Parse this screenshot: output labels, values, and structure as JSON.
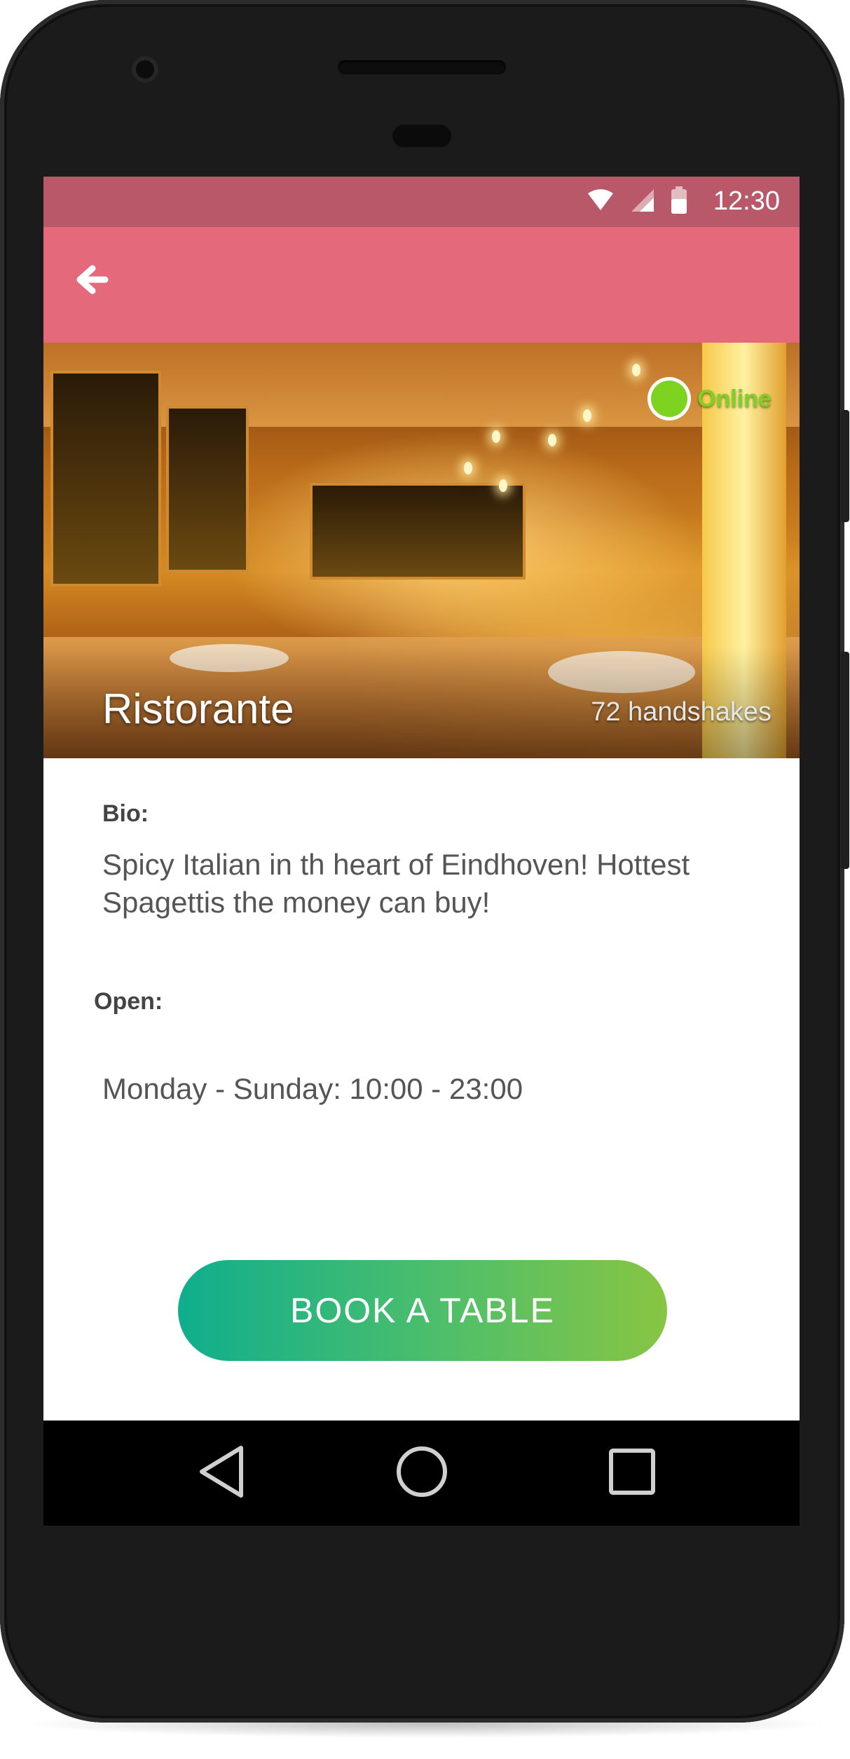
{
  "statusbar": {
    "time": "12:30"
  },
  "hero": {
    "title": "Ristorante",
    "handshakes": "72 handshakes",
    "status": "Online"
  },
  "bio": {
    "label": "Bio:",
    "text": "Spicy Italian in th heart of Eindhoven! Hottest Spagettis the money can buy!"
  },
  "open": {
    "label": "Open:",
    "hours": "Monday - Sunday: 10:00 - 23:00"
  },
  "cta": {
    "label": "BOOK A TABLE"
  },
  "colors": {
    "statusbar": "#b85868",
    "appbar": "#e46a7b",
    "online": "#7ed321",
    "button_start": "#0fae8d",
    "button_end": "#88c543"
  },
  "icons": {
    "back": "arrow-left-icon",
    "wifi": "wifi-icon",
    "signal": "signal-icon",
    "battery": "battery-icon",
    "nav_back": "triangle-back-icon",
    "nav_home": "circle-home-icon",
    "nav_recents": "square-recents-icon"
  }
}
